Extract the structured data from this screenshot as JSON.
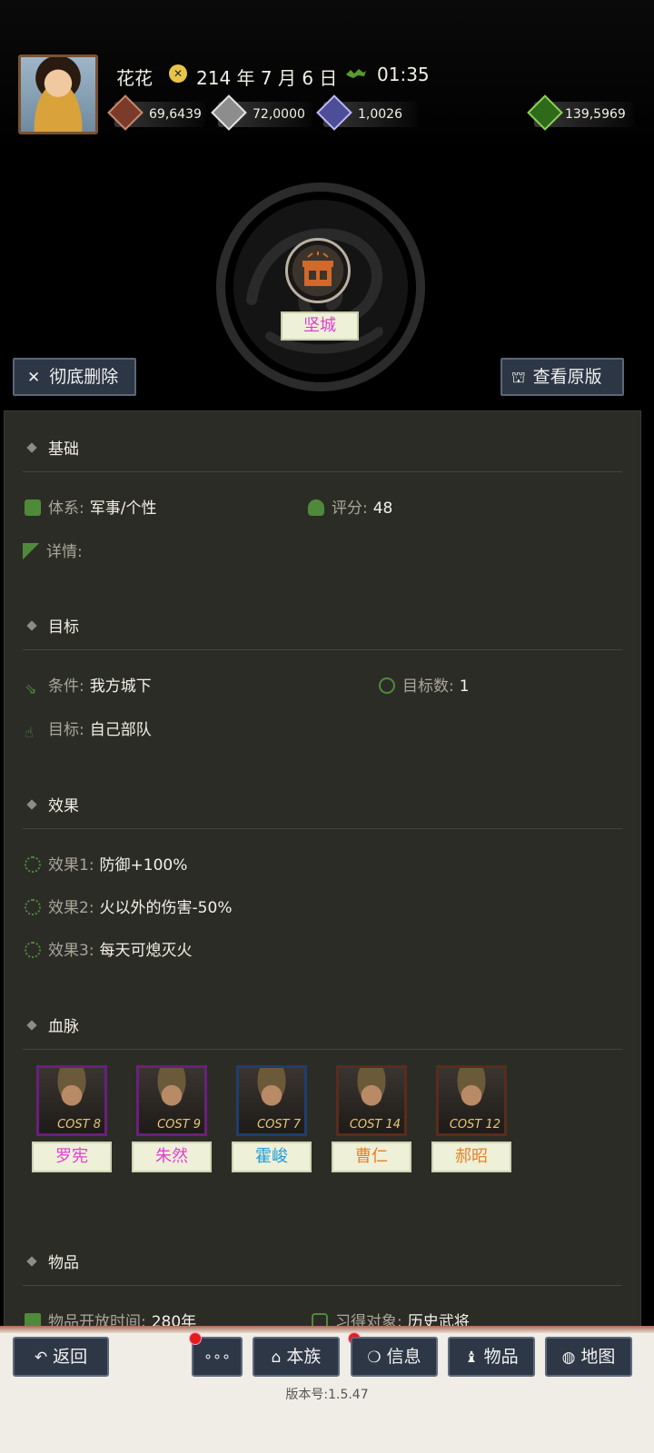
{
  "header": {
    "player_name": "花花",
    "date": "214 年 7 月 6 日",
    "time": "01:35",
    "resources": [
      {
        "icon": "money-icon",
        "value": "69,6439",
        "color": "#7a3b2a"
      },
      {
        "icon": "grain-icon",
        "value": "72,0000",
        "color": "#8d8d8d"
      },
      {
        "icon": "troops-icon",
        "value": "1,0026",
        "color": "#4d4d9a"
      },
      {
        "icon": "pouch-icon",
        "value": "139,5969",
        "color": "#2f6a1a"
      }
    ]
  },
  "skill": {
    "name": "坚城",
    "delete_label": "彻底删除",
    "view_original_label": "查看原版"
  },
  "sections": {
    "basic": {
      "title": "基础",
      "system_label": "体系:",
      "system_value": "军事/个性",
      "score_label": "评分:",
      "score_value": "48",
      "detail_label": "详情:"
    },
    "target": {
      "title": "目标",
      "condition_label": "条件:",
      "condition_value": "我方城下",
      "count_label": "目标数:",
      "count_value": "1",
      "target_label": "目标:",
      "target_value": "自己部队"
    },
    "effects": {
      "title": "效果",
      "items": [
        {
          "label": "效果1:",
          "value": "防御+100%"
        },
        {
          "label": "效果2:",
          "value": "火以外的伤害-50%"
        },
        {
          "label": "效果3:",
          "value": "每天可熄灭火"
        }
      ]
    },
    "lineage": {
      "title": "血脉",
      "generals": [
        {
          "name": "罗宪",
          "cost": "COST 8",
          "color": "#e03fd1",
          "frame": "#6a1f7e"
        },
        {
          "name": "朱然",
          "cost": "COST 9",
          "color": "#e03fd1",
          "frame": "#6a1f7e"
        },
        {
          "name": "霍峻",
          "cost": "COST 7",
          "color": "#1f9bd7",
          "frame": "#1f3d6e"
        },
        {
          "name": "曹仁",
          "cost": "COST 14",
          "color": "#e8802a",
          "frame": "#5a2c1a"
        },
        {
          "name": "郝昭",
          "cost": "COST 12",
          "color": "#e8802a",
          "frame": "#5a2c1a"
        }
      ]
    },
    "items": {
      "title": "物品",
      "open_time_label": "物品开放时间:",
      "open_time_value": "280年",
      "learner_label": "习得对象:",
      "learner_value": "历史武将"
    }
  },
  "nav": {
    "back": "返回",
    "more": "∘∘∘",
    "clan": "本族",
    "info": "信息",
    "items": "物品",
    "map": "地图"
  },
  "version": "版本号:1.5.47"
}
